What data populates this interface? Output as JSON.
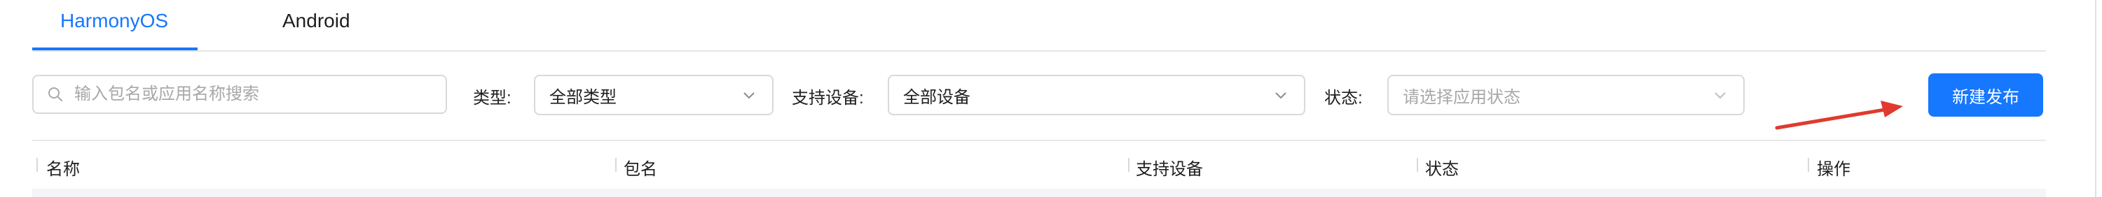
{
  "tabs": [
    {
      "label": "HarmonyOS",
      "active": true
    },
    {
      "label": "Android",
      "active": false
    }
  ],
  "search": {
    "placeholder": "输入包名或应用名称搜索",
    "value": ""
  },
  "filters": {
    "type": {
      "label": "类型:",
      "value": "全部类型"
    },
    "device": {
      "label": "支持设备:",
      "value": "全部设备"
    },
    "status": {
      "label": "状态:",
      "placeholder": "请选择应用状态"
    }
  },
  "actions": {
    "new_release": "新建发布"
  },
  "table": {
    "columns": [
      "名称",
      "包名",
      "支持设备",
      "状态",
      "操作"
    ]
  },
  "colors": {
    "accent": "#1677ff",
    "annotation_arrow": "#e03a2f"
  },
  "icons": {
    "search": "search-icon",
    "dropdown": "chevron-down-icon",
    "arrow": "annotation-arrow-icon"
  }
}
